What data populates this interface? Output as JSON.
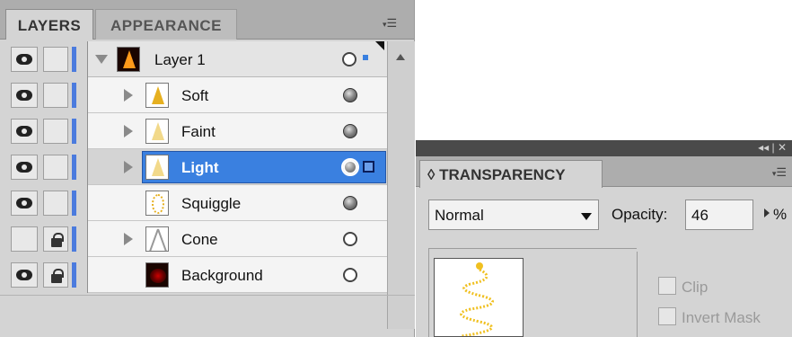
{
  "layers_panel": {
    "tabs": [
      {
        "label": "LAYERS",
        "active": true
      },
      {
        "label": "APPEARANCE",
        "active": false
      }
    ],
    "menu_icon": "panel-menu-icon",
    "layers": [
      {
        "name": "Layer 1",
        "expanded": true,
        "visible": true,
        "locked": false,
        "target_filled": false,
        "selected": false,
        "thumb": "orange-tree"
      },
      {
        "name": "Soft",
        "expanded": false,
        "visible": true,
        "locked": false,
        "target_filled": true,
        "selected": false,
        "thumb": "tree"
      },
      {
        "name": "Faint",
        "expanded": false,
        "visible": true,
        "locked": false,
        "target_filled": true,
        "selected": false,
        "thumb": "pale-tree"
      },
      {
        "name": "Light",
        "expanded": false,
        "visible": true,
        "locked": false,
        "target_filled": true,
        "selected": true,
        "thumb": "pale-tree"
      },
      {
        "name": "Squiggle",
        "expanded": false,
        "visible": true,
        "locked": false,
        "target_filled": true,
        "selected": false,
        "thumb": "squiggle"
      },
      {
        "name": "Cone",
        "expanded": false,
        "visible": false,
        "locked": true,
        "target_filled": false,
        "selected": false,
        "thumb": "cone"
      },
      {
        "name": "Background",
        "expanded": false,
        "visible": true,
        "locked": true,
        "target_filled": false,
        "selected": false,
        "thumb": "dark-glow"
      }
    ],
    "colors": {
      "layer_color": "#4b7bde",
      "selection": "#3a80e0"
    }
  },
  "transparency_panel": {
    "title": "TRANSPARENCY",
    "title_icon": "◊",
    "header_controls": "◂◂ | ✕",
    "menu_icon": "panel-menu-icon",
    "blend_mode": "Normal",
    "opacity_label": "Opacity:",
    "opacity_value": "46",
    "opacity_unit": "%",
    "clip_label": "Clip",
    "invert_mask_label": "Invert Mask"
  }
}
